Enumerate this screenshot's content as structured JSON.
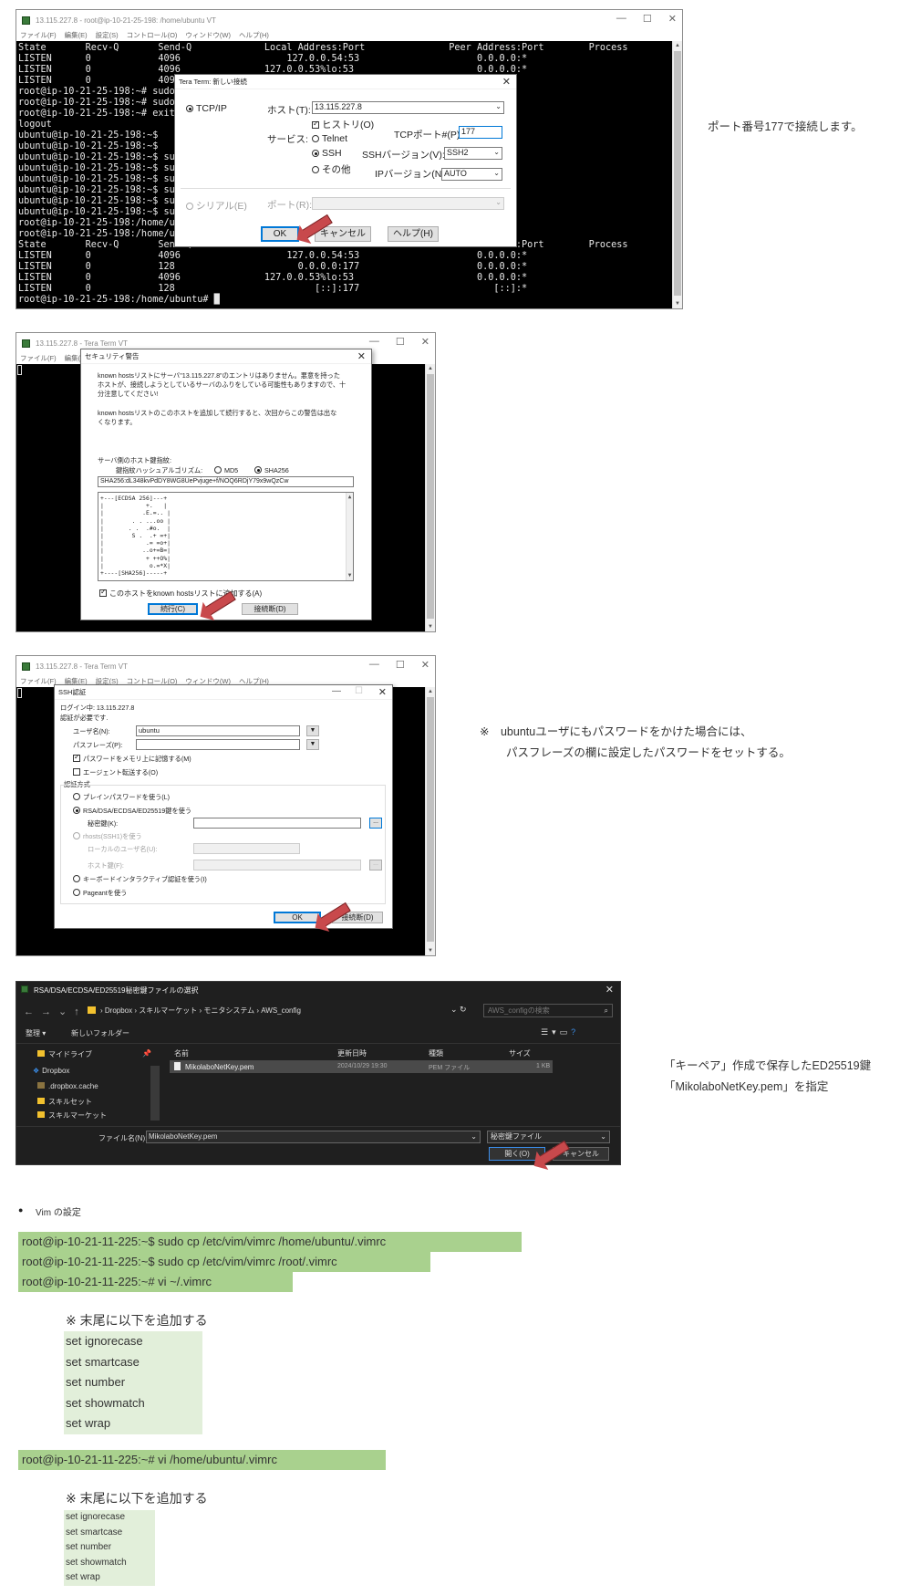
{
  "s1": {
    "win_title": "13.115.227.8 - root@ip-10-21-25-198: /home/ubuntu VT",
    "menu": [
      "ファイル(F)",
      "編集(E)",
      "設定(S)",
      "コントロール(O)",
      "ウィンドウ(W)",
      "ヘルプ(H)"
    ],
    "term_lines": [
      "State       Recv-Q       Send-Q             Local Address:Port               Peer Address:Port        Process",
      "LISTEN      0            4096                   127.0.0.54:53                     0.0.0.0:*",
      "LISTEN      0            4096               127.0.0.53%lo:53                      0.0.0.0:*",
      "LISTEN      0            4096                                                       *:*",
      "root@ip-10-21-25-198:~# sudo sy",
      "root@ip-10-21-25-198:~# sudo sy",
      "root@ip-10-21-25-198:~# exit",
      "logout",
      "ubuntu@ip-10-21-25-198:~$",
      "ubuntu@ip-10-21-25-198:~$",
      "ubuntu@ip-10-21-25-198:~$ sudo",
      "ubuntu@ip-10-21-25-198:~$ sudo",
      "ubuntu@ip-10-21-25-198:~$ sudo",
      "ubuntu@ip-10-21-25-198:~$ sudo",
      "ubuntu@ip-10-21-25-198:~$ sudo",
      "ubuntu@ip-10-21-25-198:~$ sudo",
      "root@ip-10-21-25-198:/home/ubun",
      "root@ip-10-21-25-198:/home/ubun",
      "State       Recv-Q       Send-Q             Local Address:Port               Peer Address:Port        Process",
      "LISTEN      0            4096                   127.0.0.54:53                     0.0.0.0:*",
      "LISTEN      0            128                      0.0.0.0:177                     0.0.0.0:*",
      "LISTEN      0            4096               127.0.0.53%lo:53                      0.0.0.0:*",
      "LISTEN      0            128                         [::]:177                        [::]:*",
      "root@ip-10-21-25-198:/home/ubuntu# █"
    ],
    "dlg": {
      "title": "Tera Term: 新しい接続",
      "tcpip": "TCP/IP",
      "host_label": "ホスト(T):",
      "host_value": "13.115.227.8",
      "history": "ヒストリ(O)",
      "service_label": "サービス:",
      "telnet": "Telnet",
      "ssh": "SSH",
      "other": "その他",
      "tcpport_label": "TCPポート#(P):",
      "tcpport_value": "177",
      "sshver_label": "SSHバージョン(V):",
      "sshver_value": "SSH2",
      "ipver_label": "IPバージョン(N):",
      "ipver_value": "AUTO",
      "serial": "シリアル(E)",
      "port_label": "ポート(R):",
      "ok": "OK",
      "cancel": "キャンセル",
      "help": "ヘルプ(H)"
    },
    "note": "ポート番号177で接続します。"
  },
  "s2": {
    "win_title": "13.115.227.8 - Tera Term VT",
    "menu": [
      "ファイル(F)",
      "編集(E)"
    ],
    "dlg": {
      "title": "セキュリティ警告",
      "p1": [
        "known hostsリストにサーバ\"13.115.227.8\"のエントリはありません。悪意を持った",
        "ホストが、接続しようとしているサーバのふりをしている可能性もありますので、十",
        "分注意してください!"
      ],
      "p2": [
        "known hostsリストのこのホストを追加して続行すると、次回からこの警告は出な",
        "くなります。"
      ],
      "fp_label": "サーバ側のホスト鍵指紋:",
      "algo_label": "鍵指紋ハッシュアルゴリズム:",
      "md5": "MD5",
      "sha256": "SHA256",
      "fp_value": "SHA256:dL348kvPdDY8WG8UePvjuge+f/NOQ6RDjY79x9wQzCw",
      "art": [
        "+---[ECDSA 256]---+",
        "|            +.   |",
        "|           .E.=.. |",
        "|        . . ...oo |",
        "|       . .  .#o.  |",
        "|        S .  .+ =+|",
        "|            .= =o+|",
        "|           ..o+=B=|",
        "|            + ++O%|",
        "|             o.=*X|",
        "+----[SHA256]-----+"
      ],
      "add_check": "このホストをknown hostsリストに追加する(A)",
      "continue": "続行(C)",
      "disconnect": "接続断(D)"
    }
  },
  "s3": {
    "win_title": "13.115.227.8 - Tera Term VT",
    "menu": [
      "ファイル(F)",
      "編集(E)",
      "設定(S)",
      "コントロール(O)",
      "ウィンドウ(W)",
      "ヘルプ(H)"
    ],
    "dlg": {
      "title": "SSH認証",
      "login": "ログイン中: 13.115.227.8",
      "required": "認証が必要です.",
      "user_label": "ユーザ名(N):",
      "user_value": "ubuntu",
      "pass_label": "パスフレーズ(P):",
      "remember": "パスワードをメモリ上に記憶する(M)",
      "agent": "エージェント転送する(O)",
      "method_title": "認証方式",
      "plain": "プレインパスワードを使う(L)",
      "rsa": "RSA/DSA/ECDSA/ED25519鍵を使う",
      "privkey": "秘密鍵(K):",
      "rhosts": "rhosts(SSH1)を使う",
      "local_user": "ローカルのユーザ名(U):",
      "host_key": "ホスト鍵(F):",
      "kbd": "キーボードインタラクティブ認証を使う(I)",
      "pageant": "Pageantを使う",
      "ok": "OK",
      "disconnect": "接続断(D)",
      "browse": "..."
    },
    "note1": "※　ubuntuユーザにもパスワードをかけた場合には、",
    "note2": "パスフレーズの欄に設定したパスワードをセットする。"
  },
  "s4": {
    "win_title": "RSA/DSA/ECDSA/ED25519秘密鍵ファイルの選択",
    "breadcrumb": [
      "Dropbox",
      "スキルマーケット",
      "モニタシステム",
      "AWS_config"
    ],
    "search_placeholder": "AWS_configの検索",
    "organize": "整理 ▾",
    "new_folder": "新しいフォルダー",
    "nav": [
      "マイドライブ",
      "Dropbox",
      ".dropbox.cache",
      "スキルセット",
      "スキルマーケット"
    ],
    "cols": [
      "名前",
      "更新日時",
      "種類",
      "サイズ"
    ],
    "file": {
      "name": "MikolaboNetKey.pem",
      "date": "2024/10/29 19:30",
      "type": "PEM ファイル",
      "size": "1 KB"
    },
    "filename_label": "ファイル名(N):",
    "filename_value": "MikolaboNetKey.pem",
    "filetype": "秘密鍵ファイル",
    "open": "開く(O)",
    "cancel": "キャンセル",
    "note1": "「キーペア」作成で保存したED25519鍵",
    "note2": "「MikolaboNetKey.pem」を指定"
  },
  "vim": {
    "bullet": "●",
    "heading": "Vim の設定",
    "cmd1": "root@ip-10-21-11-225:~$ sudo cp /etc/vim/vimrc /home/ubuntu/.vimrc",
    "cmd2": "root@ip-10-21-11-225:~$ sudo cp /etc/vim/vimrc /root/.vimrc",
    "cmd3": "root@ip-10-21-11-225:~# vi ~/.vimrc",
    "append_note": "※ 末尾に以下を追加する",
    "settings": [
      "set ignorecase",
      "set smartcase",
      "set number",
      "set showmatch",
      "set wrap"
    ],
    "cmd4": "root@ip-10-21-11-225:~# vi /home/ubuntu/.vimrc",
    "append_note2": "※ 末尾に以下を追加する",
    "settings2": [
      "set ignorecase",
      "set smartcase",
      "set number",
      "set showmatch",
      "set wrap"
    ]
  },
  "colors": {
    "cmd_bg": "#a9d18e",
    "list_bg": "#e2efda",
    "arrow": "#c8494c",
    "term_bg": "#000000"
  }
}
